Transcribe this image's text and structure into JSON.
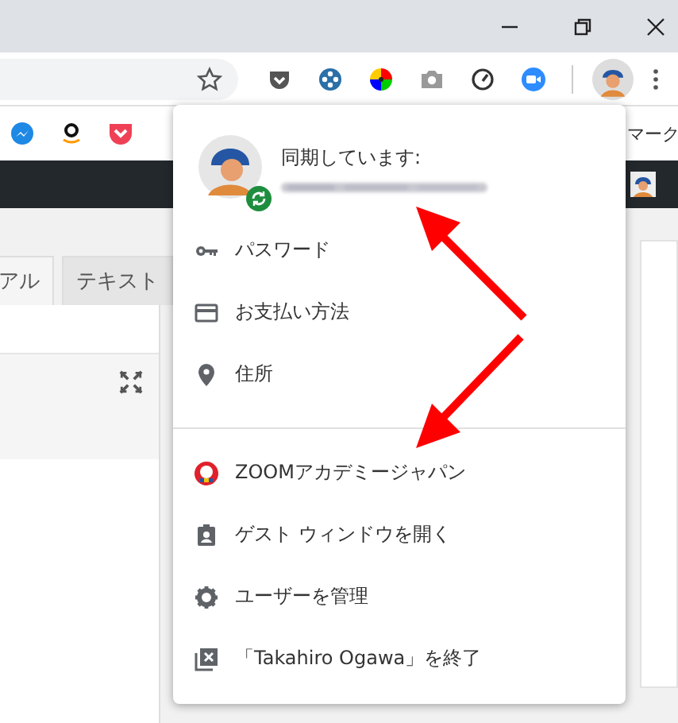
{
  "bookmarks_bar": {
    "trailing_text": "マーク"
  },
  "page_tabs": [
    {
      "label": "アル",
      "selected": true
    },
    {
      "label": "テキスト",
      "selected": false
    }
  ],
  "profile_menu": {
    "sync_status": "同期しています:",
    "sections": [
      [
        {
          "kind": "password",
          "label": "パスワード"
        },
        {
          "kind": "payment",
          "label": "お支払い方法"
        },
        {
          "kind": "address",
          "label": "住所"
        }
      ],
      [
        {
          "kind": "profile",
          "label": "ZOOMアカデミージャパン"
        },
        {
          "kind": "guest",
          "label": "ゲスト ウィンドウを開く"
        },
        {
          "kind": "manage",
          "label": "ユーザーを管理"
        },
        {
          "kind": "exit",
          "label": "「Takahiro Ogawa」を終了"
        }
      ]
    ]
  }
}
